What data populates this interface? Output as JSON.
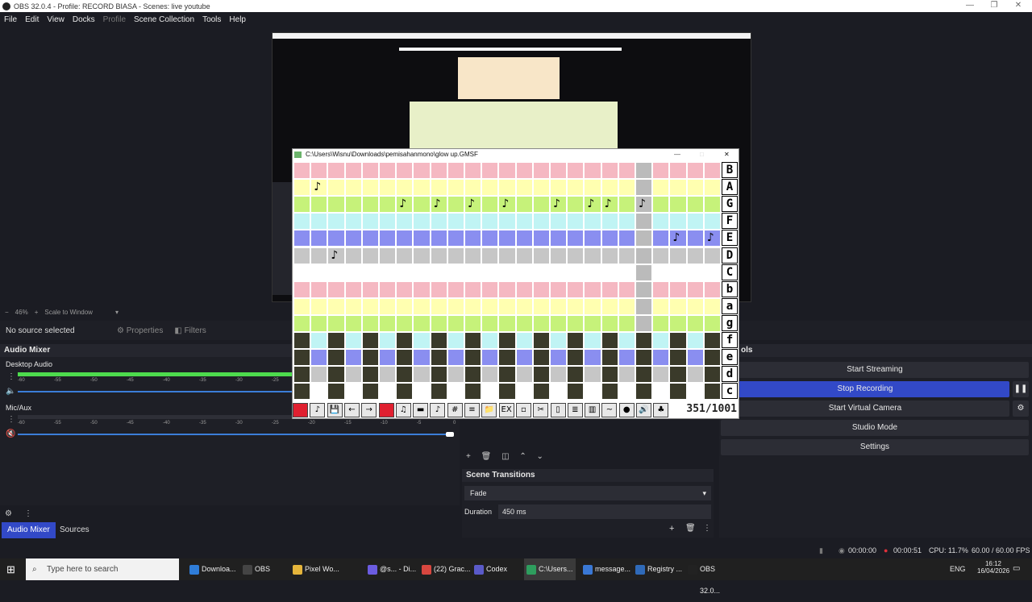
{
  "window": {
    "title": "OBS 32.0.4 - Profile: RECORD BIASA - Scenes: live youtube"
  },
  "menu": [
    "File",
    "Edit",
    "View",
    "Docks",
    "Profile",
    "Scene Collection",
    "Tools",
    "Help"
  ],
  "preview": {
    "zoom": "46%",
    "scale_mode": "Scale to Window"
  },
  "sources": {
    "no_selection": "No source selected",
    "properties": "Properties",
    "filters": "Filters"
  },
  "mixer": {
    "title": "Audio Mixer",
    "channels": [
      {
        "name": "Desktop Audio",
        "level": 0.75
      },
      {
        "name": "Mic/Aux",
        "level": 0.0
      }
    ],
    "ticks": [
      "-60",
      "-55",
      "-50",
      "-45",
      "-40",
      "-35",
      "-30",
      "-25",
      "-20",
      "-15",
      "-10",
      "-5",
      "0"
    ]
  },
  "transitions": {
    "title": "Scene Transitions",
    "selected": "Fade",
    "duration_label": "Duration",
    "duration_value": "450 ms"
  },
  "controls": {
    "title": "ols",
    "start_streaming": "Start Streaming",
    "stop_recording": "Stop Recording",
    "start_virtual_camera": "Start Virtual Camera",
    "studio_mode": "Studio Mode",
    "settings": "Settings"
  },
  "dock_tabs": [
    "Audio Mixer",
    "Sources"
  ],
  "status": {
    "stream_time": "00:00:00",
    "rec_time": "00:00:51",
    "cpu": "CPU: 11.7%",
    "fps": "60.00 / 60.00 FPS"
  },
  "gmsf": {
    "title": "C:\\Users\\Wisnu\\Downloads\\pemisahanmono\\glow up.GMSF",
    "row_labels": [
      "B",
      "A",
      "G",
      "F",
      "E",
      "D",
      "C",
      "b",
      "a",
      "g",
      "f",
      "e",
      "d",
      "c"
    ],
    "row_colors": [
      "#f5b8c2",
      "#ffffb0",
      "#c6f27a",
      "#c0f4f4",
      "#8a8ef0",
      "#c6c6c6",
      "#ffffff",
      "#f5b8c2",
      "#ffffb0",
      "#c6f27a",
      "#c0f4f4",
      "#8a8ef0",
      "#c6c6c6",
      "#ffffff"
    ],
    "counter": "351/1001",
    "tools": [
      "",
      "♪",
      "💾",
      "←",
      "→",
      "",
      "♫",
      "▬",
      "♪",
      "#",
      "≡",
      "📁",
      "EX",
      "▫",
      "✂",
      "▯",
      "≣",
      "▥",
      "~",
      "●",
      "🔊",
      "♣"
    ]
  },
  "taskbar": {
    "search": "Type here to search",
    "items": [
      "Downloa...",
      "OBS",
      "Pixel Wo...",
      "@s... - Di...",
      "(22) Grac...",
      "Codex",
      "C:\\Users...",
      "message...",
      "Registry ...",
      "OBS 32.0..."
    ],
    "lang": "ENG",
    "time": "16:12",
    "date": "16/04/2026"
  }
}
